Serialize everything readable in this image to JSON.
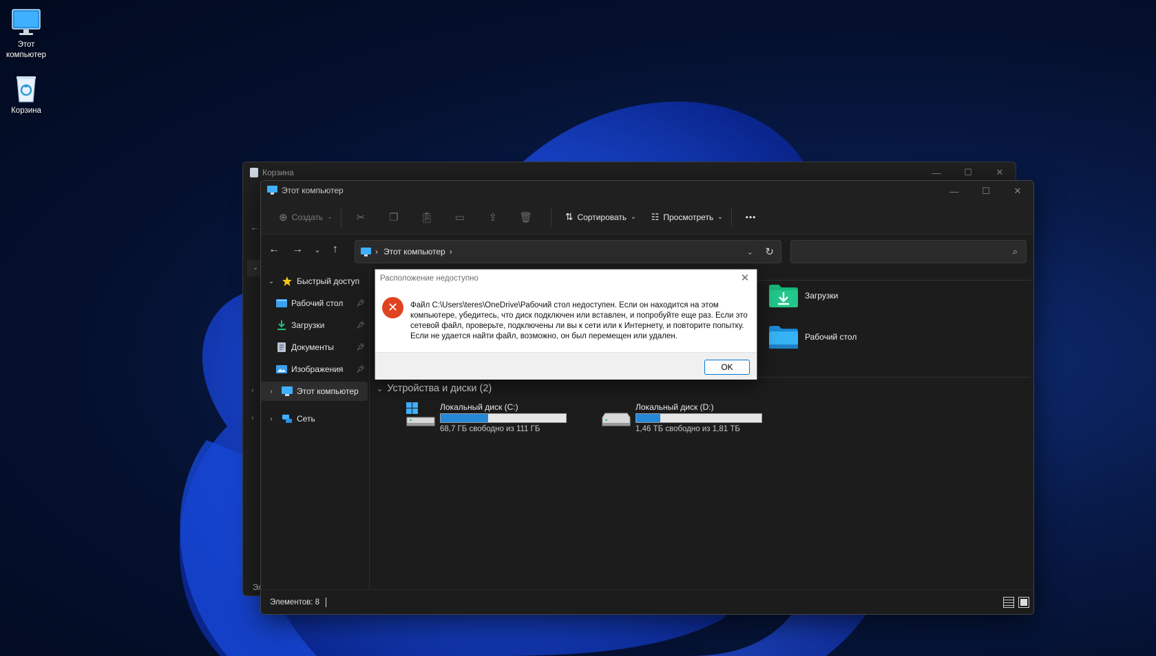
{
  "desktop": {
    "icons": [
      {
        "label": "Этот компьютер",
        "icon": "monitor-icon"
      },
      {
        "label": "Корзина",
        "icon": "recycle-bin-icon"
      }
    ]
  },
  "back_window": {
    "title": "Корзина",
    "sidebar_fragment": "Эл"
  },
  "window": {
    "title": "Этот компьютер",
    "toolbar": {
      "create_label": "Создать",
      "sort_label": "Сортировать",
      "view_label": "Просмотреть",
      "more_label": "•••"
    },
    "address": {
      "location": "Этот компьютер"
    },
    "search": {
      "placeholder": ""
    },
    "sidebar": {
      "quick_access": "Быстрый доступ",
      "items": [
        {
          "label": "Рабочий стол",
          "icon": "desktop-folder-icon"
        },
        {
          "label": "Загрузки",
          "icon": "downloads-icon"
        },
        {
          "label": "Документы",
          "icon": "documents-icon"
        },
        {
          "label": "Изображения",
          "icon": "pictures-icon"
        }
      ],
      "this_pc": "Этот компьютер",
      "network": "Сеть"
    },
    "folders": [
      {
        "label": "Загрузки",
        "icon": "downloads-folder-icon"
      },
      {
        "label": "Рабочий стол",
        "icon": "desktop-folder-icon"
      }
    ],
    "devices": {
      "header": "Устройства и диски (2)",
      "drives": [
        {
          "name": "Локальный диск (C:)",
          "free": "68,7 ГБ свободно из 111 ГБ",
          "used_fraction": 0.38
        },
        {
          "name": "Локальный диск (D:)",
          "free": "1,46 ТБ свободно из 1,81 ТБ",
          "used_fraction": 0.19
        }
      ]
    },
    "status": {
      "items": "Элементов: 8"
    }
  },
  "dialog": {
    "title": "Расположение недоступно",
    "message": "Файл C:\\Users\\teres\\OneDrive\\Рабочий стол недоступен. Если он находится на этом компьютере, убедитесь, что диск подключен или вставлен, и попробуйте еще раз. Если это сетевой файл, проверьте, подключены ли вы к сети или к Интернету, и повторите попытку. Если не удается найти файл, возможно, он был перемещен или удален.",
    "ok_label": "OK"
  },
  "colors": {
    "accent": "#2688d9",
    "error": "#e0431f",
    "window_bg": "#1c1c1c"
  }
}
